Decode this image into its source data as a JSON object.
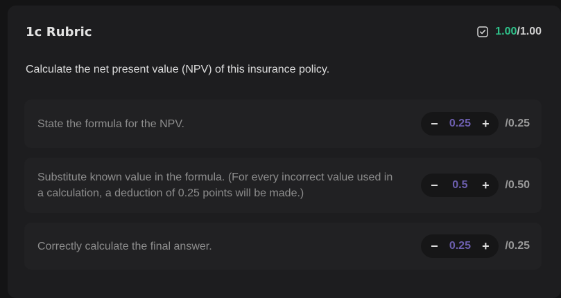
{
  "rubric": {
    "title": "1c Rubric",
    "score_earned": "1.00",
    "score_max": "/1.00",
    "check_icon": "checkbox-check-icon",
    "accent_color": "#2fc18a",
    "value_color": "#6d5fb0"
  },
  "question": "Calculate the net present value (NPV) of this insurance policy.",
  "criteria": [
    {
      "text": "State the formula for the NPV.",
      "value": "0.25",
      "max": "/0.25",
      "minus": "−",
      "plus": "+"
    },
    {
      "text": "Substitute known value in the formula. (For every incorrect value used in a calculation, a deduction of 0.25 points will be made.)",
      "value": "0.5",
      "max": "/0.50",
      "minus": "−",
      "plus": "+"
    },
    {
      "text": "Correctly calculate the final answer.",
      "value": "0.25",
      "max": "/0.25",
      "minus": "−",
      "plus": "+"
    }
  ]
}
